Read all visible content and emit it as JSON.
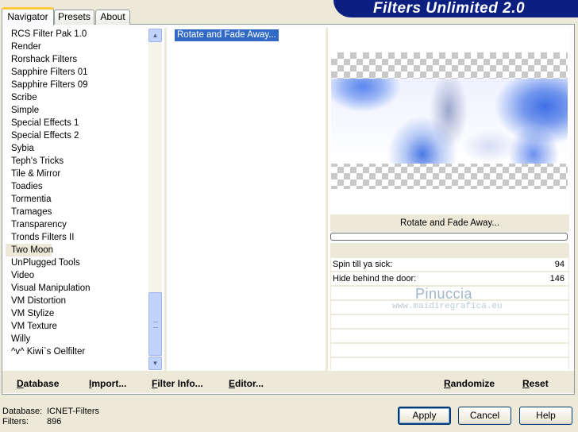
{
  "app": {
    "title": "Filters Unlimited 2.0"
  },
  "tabs": [
    {
      "label": "Navigator",
      "active": true
    },
    {
      "label": "Presets",
      "active": false
    },
    {
      "label": "About",
      "active": false
    }
  ],
  "filter_categories": [
    "RCS Filter Pak 1.0",
    "Render",
    "Rorshack Filters",
    "Sapphire Filters 01",
    "Sapphire Filters 09",
    "Scribe",
    "Simple",
    "Special Effects 1",
    "Special Effects 2",
    "Sybia",
    "Teph's Tricks",
    "Tile & Mirror",
    "Toadies",
    "Tormentia",
    "Tramages",
    "Transparency",
    "Tronds Filters II",
    "Two Moon",
    "UnPlugged Tools",
    "Video",
    "Visual Manipulation",
    "VM Distortion",
    "VM Stylize",
    "VM Texture",
    "Willy",
    "^v^ Kiwi`s Oelfilter"
  ],
  "selected_category": "Two Moon",
  "filters": {
    "selected": "Rotate and Fade Away..."
  },
  "preview": {
    "filter_name": "Rotate and Fade Away...",
    "params": [
      {
        "label": "Spin till ya sick:",
        "value": "94"
      },
      {
        "label": "Hide behind the door:",
        "value": "146"
      }
    ],
    "watermark_name": "Pinuccia",
    "watermark_url": "www.maidiregrafica.eu"
  },
  "actions": {
    "database": "Database",
    "import": "Import...",
    "filter_info": "Filter Info...",
    "editor": "Editor...",
    "randomize": "Randomize",
    "reset": "Reset"
  },
  "status": {
    "database_label": "Database:",
    "database_value": "ICNET-Filters",
    "filters_label": "Filters:",
    "filters_value": "896"
  },
  "dialog_buttons": {
    "apply": "Apply",
    "cancel": "Cancel",
    "help": "Help"
  },
  "colors": {
    "selection": "#316ac5",
    "banner": "#0a1f80",
    "tab_highlight": "#ffc83c"
  }
}
